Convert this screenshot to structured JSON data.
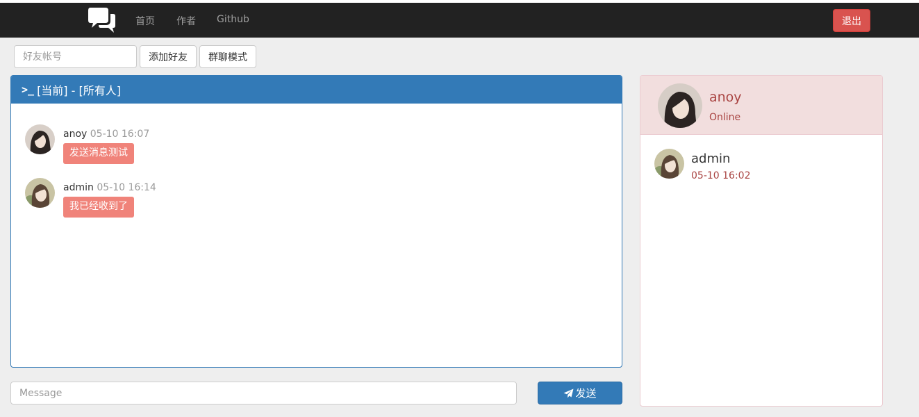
{
  "navbar": {
    "brand_icon": "chat-bubbles-icon",
    "links": [
      "首页",
      "作者",
      "Github"
    ],
    "logout_label": "退出",
    "logout_color": "#d9534f"
  },
  "toolbar": {
    "friend_input_placeholder": "好友帐号",
    "add_friend_label": "添加好友",
    "group_chat_label": "群聊模式"
  },
  "chat": {
    "heading_icon": "terminal-icon",
    "heading_text": "[当前] - [所有人]",
    "accent_color": "#337ab7",
    "messages": [
      {
        "user": "anoy",
        "time": "05-10 16:07",
        "text": "发送消息测试"
      },
      {
        "user": "admin",
        "time": "05-10 16:14",
        "text": "我已经收到了"
      }
    ],
    "bubble_color": "#f0837a",
    "message_placeholder": "Message",
    "send_label": "发送",
    "send_icon": "paper-plane-icon"
  },
  "sidebar": {
    "current_user": {
      "name": "anoy",
      "status": "Online"
    },
    "contacts": [
      {
        "name": "admin",
        "time": "05-10 16:02"
      }
    ],
    "theme_color": "#f2dede"
  }
}
